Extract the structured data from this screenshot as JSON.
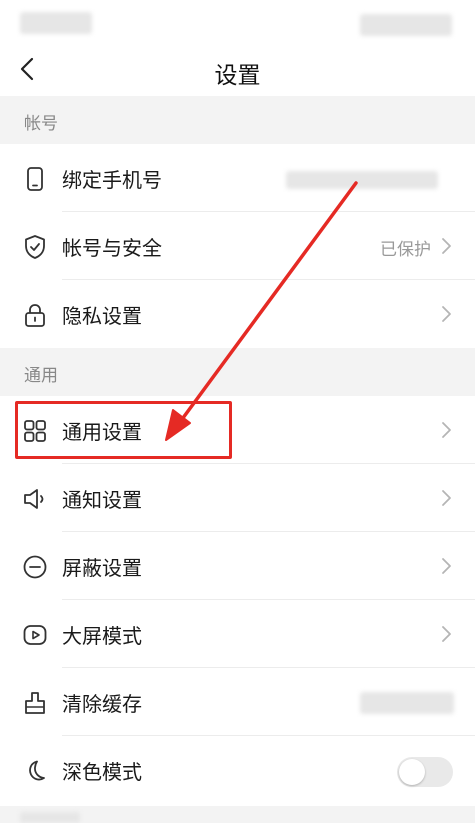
{
  "header": {
    "title": "设置"
  },
  "sections": {
    "account": {
      "title": "帐号",
      "items": [
        {
          "label": "绑定手机号",
          "icon": "phone-icon"
        },
        {
          "label": "帐号与安全",
          "value": "已保护",
          "icon": "shield-check-icon"
        },
        {
          "label": "隐私设置",
          "icon": "lock-icon"
        }
      ]
    },
    "general": {
      "title": "通用",
      "items": [
        {
          "label": "通用设置",
          "icon": "grid-icon"
        },
        {
          "label": "通知设置",
          "icon": "speaker-icon"
        },
        {
          "label": "屏蔽设置",
          "icon": "block-icon"
        },
        {
          "label": "大屏模式",
          "icon": "play-screen-icon"
        },
        {
          "label": "清除缓存",
          "icon": "broom-icon"
        },
        {
          "label": "深色模式",
          "icon": "moon-icon",
          "toggle_on": false
        }
      ]
    }
  },
  "colors": {
    "annotation_red": "#e52a24",
    "divider": "#ececec",
    "section_bg": "#f3f3f3"
  }
}
